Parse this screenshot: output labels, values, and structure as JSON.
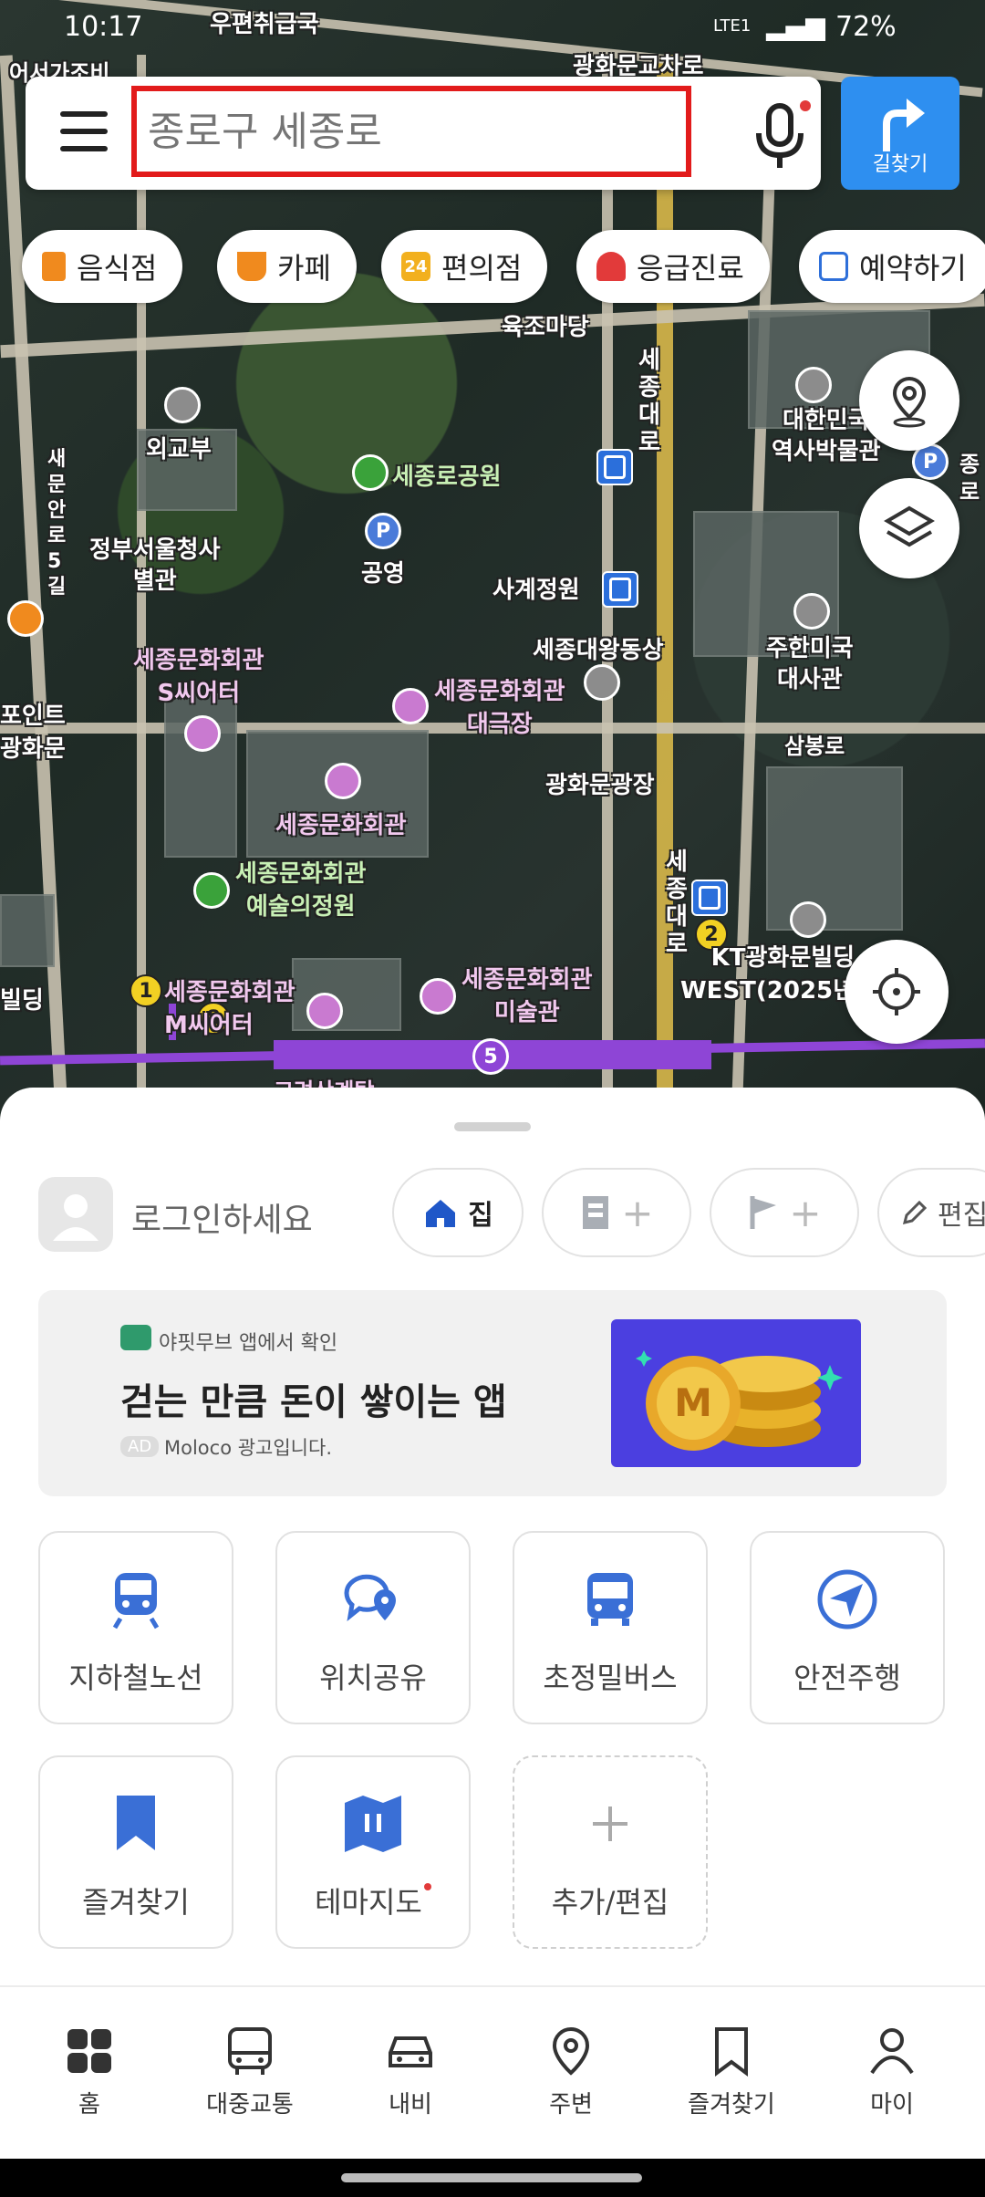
{
  "status_bar": {
    "time": "10:17",
    "battery": "72%",
    "network": "LTE1"
  },
  "search": {
    "placeholder": "종로구 세종로"
  },
  "route_button": {
    "label": "길찾기"
  },
  "chips": [
    {
      "label": "음식점",
      "icon": "restaurant-icon",
      "color": "#f08a1e"
    },
    {
      "label": "카페",
      "icon": "cafe-icon",
      "color": "#f08a1e"
    },
    {
      "label": "편의점",
      "icon": "store-24-icon",
      "color": "#f2b01e",
      "badge": "24"
    },
    {
      "label": "응급진료",
      "icon": "siren-icon",
      "color": "#e23a3a"
    },
    {
      "label": "예약하기",
      "icon": "calendar-icon",
      "color": "#2e6fd9"
    }
  ],
  "map_labels": {
    "top_left": "어서가조비",
    "top_post": "우편취급국",
    "intersection": "광화문교차로",
    "yukjomadang": "육조마당",
    "sejongdaero": "세종대로",
    "sejongdaero_2": "세종대로",
    "museum": "대한민국\n역사박물관",
    "oegyobu": "외교부",
    "sejongro_park": "세종로공원",
    "government": "정부서울청사\n별관",
    "gongyeong": "공영",
    "sagye": "사계정원",
    "statue": "세종대왕동상",
    "us_embassy": "주한미국\n대사관",
    "sejong_s_theater": "세종문화회관\nS씨어터",
    "sejong_grand": "세종문화회관\n대극장",
    "gwanghwamun_square": "광화문광장",
    "sambongro": "삼봉로",
    "sejong_center": "세종문화회관",
    "sejong_art_garden": "세종문화회관\n예술의정원",
    "sejong_m_theater": "세종문화회관\nM씨어터",
    "sejong_museum": "세종문화회관\n미술관",
    "kt": "KT광화문빌딩\nWEST(2025년",
    "point": "포인트",
    "gwanghwamun": "광화문",
    "building": "빌딩",
    "saemunanro": "새문안로5길",
    "exit1": "1",
    "exit8": "8",
    "exit2": "2",
    "line5": "5",
    "goryeo": "고려산계탕",
    "jongro_right": "종로"
  },
  "sheet": {
    "login": "로그인하세요",
    "home_chip": "집",
    "work_add": "+",
    "flag_add": "+",
    "edit": "편집"
  },
  "ad": {
    "source": "야핏무브 앱에서 확인",
    "headline": "걷는 만큼 돈이 쌓이는 앱",
    "ad_tag": "AD",
    "ad_text": "Moloco 광고입니다.",
    "coin_letter": "M"
  },
  "tiles": [
    {
      "label": "지하철노선",
      "icon": "subway-icon"
    },
    {
      "label": "위치공유",
      "icon": "location-share-icon"
    },
    {
      "label": "초정밀버스",
      "icon": "bus-icon"
    },
    {
      "label": "안전주행",
      "icon": "navigation-arrow-icon"
    },
    {
      "label": "즐겨찾기",
      "icon": "bookmark-icon"
    },
    {
      "label": "테마지도",
      "icon": "theme-map-icon"
    },
    {
      "label": "추가/편집",
      "icon": "plus-icon"
    }
  ],
  "nav": [
    {
      "label": "홈",
      "icon": "home-grid-icon"
    },
    {
      "label": "대중교통",
      "icon": "bus-icon"
    },
    {
      "label": "내비",
      "icon": "car-icon"
    },
    {
      "label": "주변",
      "icon": "pin-icon"
    },
    {
      "label": "즐겨찾기",
      "icon": "bookmark-icon"
    },
    {
      "label": "마이",
      "icon": "person-icon"
    }
  ]
}
